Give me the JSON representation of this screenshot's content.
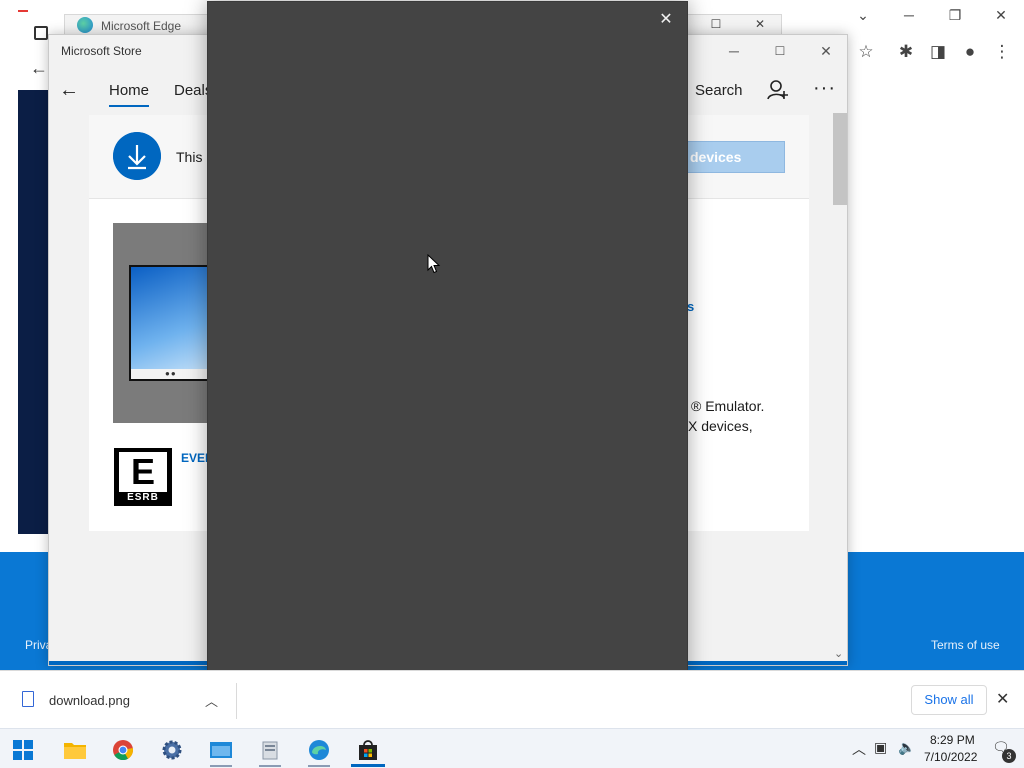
{
  "edge_window": {
    "title": "Microsoft Edge"
  },
  "store_window": {
    "title": "Microsoft Store",
    "nav": {
      "tabs": [
        "Home",
        "Deals"
      ],
      "search_label": "Search"
    },
    "banner": {
      "text": "This",
      "button_label": "devices"
    },
    "rating_link": "EVER",
    "side_link": "s",
    "description_lines": [
      "® Emulator.",
      "X devices,"
    ],
    "esrb": {
      "letter": "E",
      "label": "ESRB"
    }
  },
  "page_footer": {
    "left_link": "Priva",
    "right_link": "Terms of use"
  },
  "downloads_bar": {
    "file_name": "download.png",
    "show_all_label": "Show all"
  },
  "taskbar": {
    "time": "8:29 PM",
    "date": "7/10/2022",
    "notification_count": "3"
  },
  "colors": {
    "accent": "#0067c0",
    "dialog_bg": "#444444",
    "footer_blue": "#0a78d4"
  }
}
